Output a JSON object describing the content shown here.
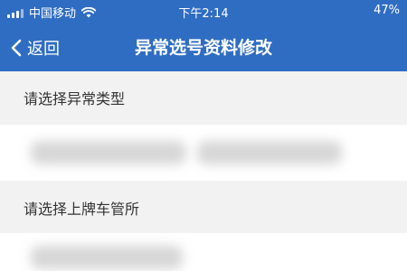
{
  "status_bar": {
    "carrier": "中国移动",
    "wifi_icon": "wifi-icon",
    "time": "下午2:14",
    "battery": "47%"
  },
  "nav": {
    "back_label": "返回",
    "title": "异常选号资料修改"
  },
  "sections": [
    {
      "label": "请选择异常类型"
    },
    {
      "label": "请选择上牌车管所"
    }
  ],
  "colors": {
    "header_bg": "#2f6dc3",
    "page_bg": "#f2f2f2",
    "text": "#333333"
  }
}
